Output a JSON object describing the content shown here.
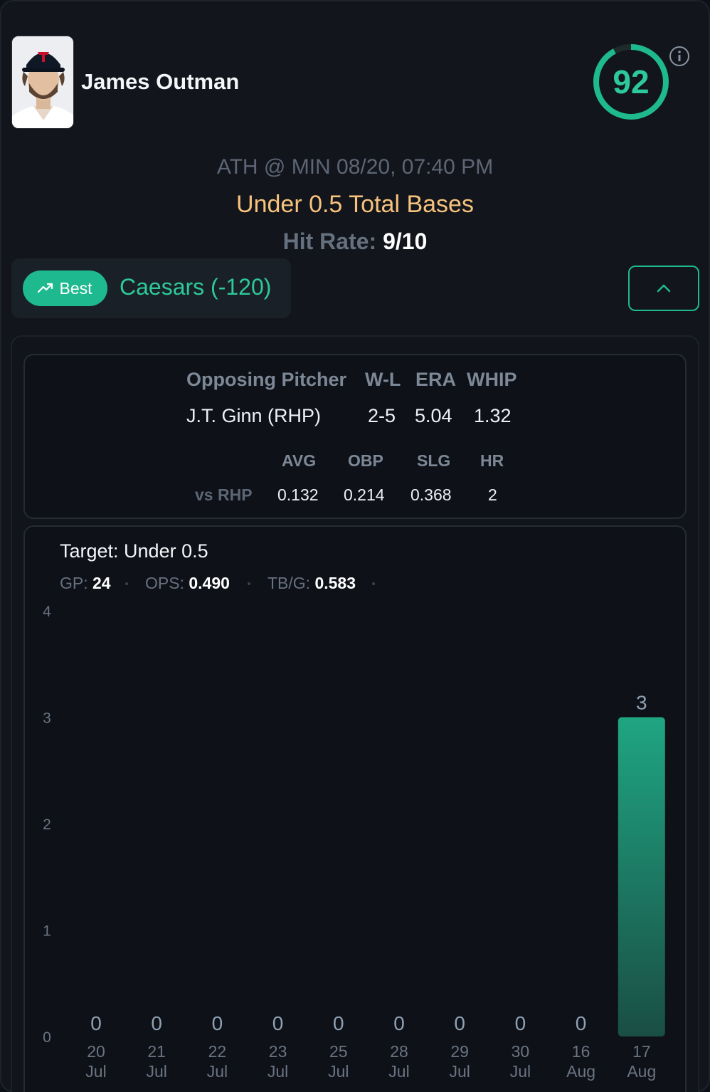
{
  "player": {
    "name": "James Outman",
    "photo_icon": "player-headshot-twins-cap",
    "score": "92",
    "score_fraction": 0.92
  },
  "game": {
    "matchup": "ATH @ MIN 08/20, 07:40 PM",
    "prop": "Under 0.5 Total Bases",
    "hit_rate_label": "Hit Rate:",
    "hit_rate_value": "9/10"
  },
  "book": {
    "best_label": "Best",
    "best_icon": "trending-up-icon",
    "name": "Caesars (-120)"
  },
  "collapse_icon": "chevron-up-icon",
  "pitcher": {
    "headers": [
      "Opposing Pitcher",
      "W-L",
      "ERA",
      "WHIP"
    ],
    "values": [
      "J.T. Ginn (RHP)",
      "2-5",
      "5.04",
      "1.32"
    ],
    "split_headers": [
      "AVG",
      "OBP",
      "SLG",
      "HR"
    ],
    "split_label": "vs RHP",
    "split_values": [
      "0.132",
      "0.214",
      "0.368",
      "2"
    ]
  },
  "summary": {
    "target": "Target: Under 0.5",
    "gp_label": "GP:",
    "gp_value": "24",
    "ops_label": "OPS:",
    "ops_value": "0.490",
    "tbg_label": "TB/G:",
    "tbg_value": "0.583"
  },
  "colors": {
    "accent": "#1fb990",
    "prop": "#f7c27c",
    "bar_top": "#1fa582",
    "bar_bottom": "#1a4e45"
  },
  "chart_data": {
    "type": "bar",
    "categories": [
      [
        "20",
        "Jul"
      ],
      [
        "21",
        "Jul"
      ],
      [
        "22",
        "Jul"
      ],
      [
        "23",
        "Jul"
      ],
      [
        "25",
        "Jul"
      ],
      [
        "28",
        "Jul"
      ],
      [
        "29",
        "Jul"
      ],
      [
        "30",
        "Jul"
      ],
      [
        "16",
        "Aug"
      ],
      [
        "17",
        "Aug"
      ]
    ],
    "values": [
      0,
      0,
      0,
      0,
      0,
      0,
      0,
      0,
      0,
      3
    ],
    "yticks": [
      0,
      1,
      2,
      3,
      4
    ],
    "ylim": [
      0,
      4
    ],
    "grid": false,
    "data_labels": true
  }
}
